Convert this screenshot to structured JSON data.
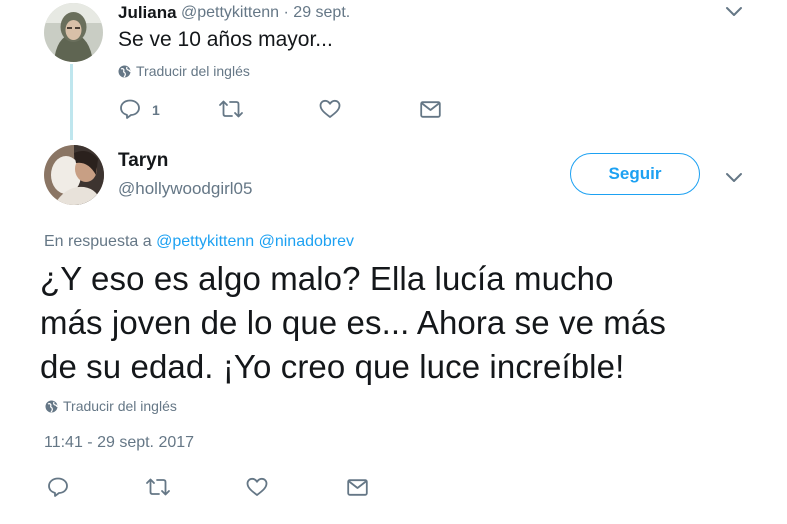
{
  "reply_tweet": {
    "display_name": "Juliana",
    "handle_date": "@pettykittenn · 29 sept.",
    "text": "Se ve 10 años mayor...",
    "translate": "Traducir del inglés",
    "reply_count": "1",
    "avatar_icon": "user-avatar-hooded",
    "menu_icon": "chevron-down-icon"
  },
  "main_tweet": {
    "display_name": "Taryn",
    "handle": "@hollywoodgirl05",
    "follow_label": "Seguir",
    "reply_prefix": "En respuesta a",
    "mention_1": "@pettykittenn",
    "mention_2": "@ninadobrev",
    "text_line_1": "¿Y eso es algo malo? Ella lucía mucho",
    "text_line_2": "más joven de lo que es... Ahora se ve más",
    "text_line_3": "de su edad. ¡Yo creo que luce increíble!",
    "translate": "Traducir del inglés",
    "timestamp": "11:41 - 29 sept. 2017"
  },
  "colors": {
    "accent": "#1da1f2",
    "muted": "#657786",
    "thread_line": "#bfe6ee",
    "text": "#14171a"
  }
}
